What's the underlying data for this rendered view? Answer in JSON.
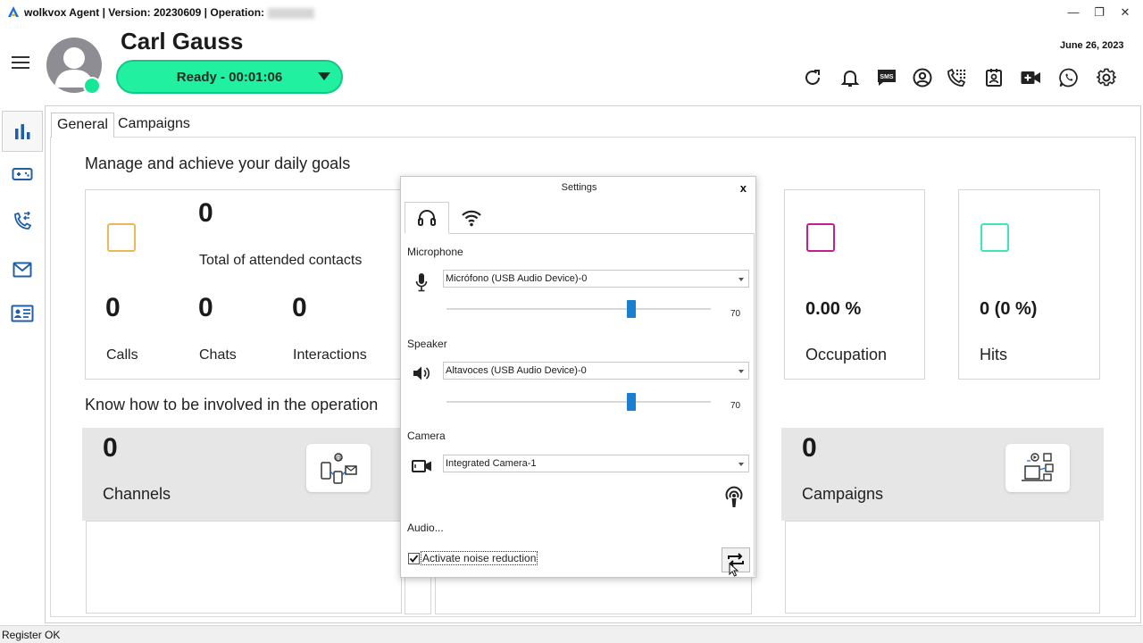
{
  "window": {
    "title": "wolkvox Agent | Version: 20230609  | Operation:",
    "minimize": "—",
    "restore": "❐",
    "close": "✕"
  },
  "header": {
    "agent_name": "Carl Gauss",
    "status_label": "Ready  -  00:01:06",
    "date": "June 26, 2023",
    "toolbar_icons": [
      "refresh-icon",
      "bell-icon",
      "sms-icon",
      "user-circle-icon",
      "dialpad-icon",
      "contact-card-icon",
      "video-add-icon",
      "whatsapp-icon",
      "gear-icon"
    ],
    "sms_text": "SMS"
  },
  "rail": {
    "items": [
      "bar-chart-icon",
      "gamepad-icon",
      "phone-transfer-icon",
      "mail-icon",
      "id-card-icon"
    ]
  },
  "tabs": [
    "General",
    "Campaigns"
  ],
  "goals": {
    "title": "Manage and achieve your daily goals",
    "total_value": "0",
    "total_label": "Total of attended contacts",
    "calls_value": "0",
    "calls_label": "Calls",
    "chats_value": "0",
    "chats_label": "Chats",
    "interactions_value": "0",
    "interactions_label": "Interactions",
    "occupation_value": "0.00 %",
    "occupation_label": "Occupation",
    "hits_value": "0 (0 %)",
    "hits_label": "Hits"
  },
  "operation": {
    "title": "Know how to be involved in the operation",
    "channels_value": "0",
    "channels_label": "Channels",
    "campaigns_value": "0",
    "campaigns_label": "Campaigns"
  },
  "settings": {
    "title": "Settings",
    "close": "x",
    "microphone_label": "Microphone",
    "microphone_device": "Micrófono (USB Audio Device)-0",
    "microphone_level": 70,
    "microphone_level_text": "70",
    "speaker_label": "Speaker",
    "speaker_device": "Altavoces (USB Audio Device)-0",
    "speaker_level": 70,
    "speaker_level_text": "70",
    "camera_label": "Camera",
    "camera_device": "Integrated Camera-1",
    "audio_label": "Audio...",
    "noise_reduction_label": "Activate noise reduction",
    "noise_reduction_checked": true
  },
  "statusbar": {
    "text": "Register OK"
  },
  "colors": {
    "status_green": "#20f0a0",
    "calls_square": "#e8b85a",
    "occupation_square": "#c0208f",
    "hits_square": "#40e8b0",
    "slider_blue": "#1a7fd0"
  }
}
